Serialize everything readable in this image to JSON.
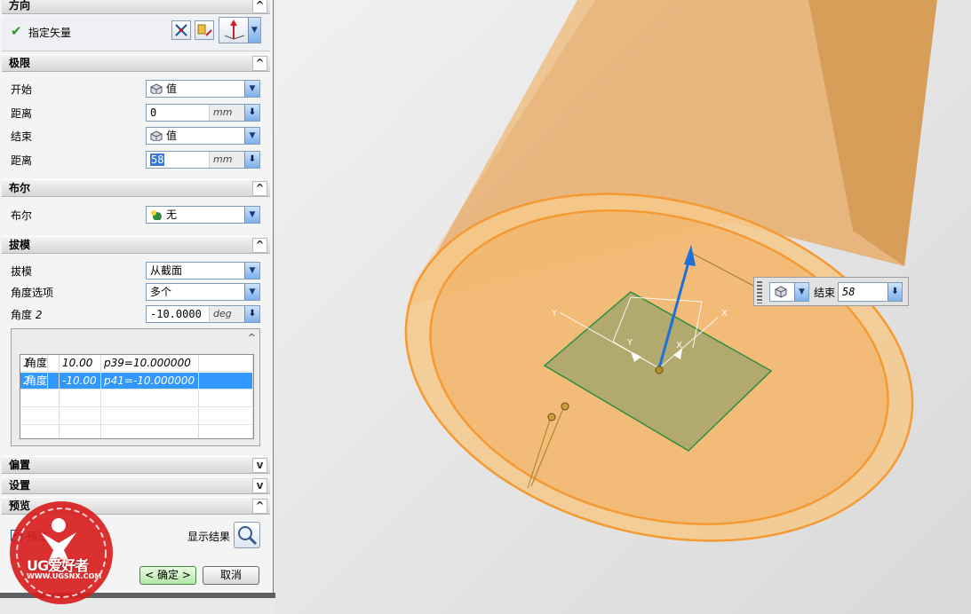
{
  "panel": {
    "direction": {
      "title": "方向",
      "specify_vector": "指定矢量",
      "check_icon": "check-icon"
    },
    "limits": {
      "title": "极限",
      "start_label": "开始",
      "start_value": "值",
      "start_distance_label": "距离",
      "start_distance": "0",
      "start_unit": "mm",
      "end_label": "结束",
      "end_value": "值",
      "end_distance_label": "距离",
      "end_distance": "58",
      "end_unit": "mm"
    },
    "boolean": {
      "title": "布尔",
      "label": "布尔",
      "value": "无"
    },
    "draft": {
      "title": "拔模",
      "draft_label": "拔模",
      "draft_value": "从截面",
      "angle_option_label": "角度选项",
      "angle_option_value": "多个",
      "angle2_label": "角度",
      "angle2_index": "2",
      "angle2_value": "-10.0000",
      "angle2_unit": "deg",
      "list": [
        {
          "name": "角度",
          "idx": "1",
          "value": "10.00",
          "expr": "p39=10.000000"
        },
        {
          "name": "角度",
          "idx": "2",
          "value": "-10.00",
          "expr": "p41=-10.000000"
        }
      ]
    },
    "offset": {
      "title": "偏置"
    },
    "settings": {
      "title": "设置"
    },
    "preview": {
      "title": "预览",
      "checkbox_label": "预览",
      "show_result": "显示结果"
    },
    "buttons": {
      "ok": "< 确定 >",
      "cancel": "取消"
    }
  },
  "float_toolbar": {
    "label": "结束",
    "value": "58"
  },
  "watermark": {
    "brand": "UG爱好者",
    "url": "WWW.UGSNX.COM"
  },
  "colors": {
    "cylinder": "#f2a64a",
    "plane": "#2f8f3f",
    "vector": "#1e6fd8",
    "accent_blue": "#3398fd"
  }
}
